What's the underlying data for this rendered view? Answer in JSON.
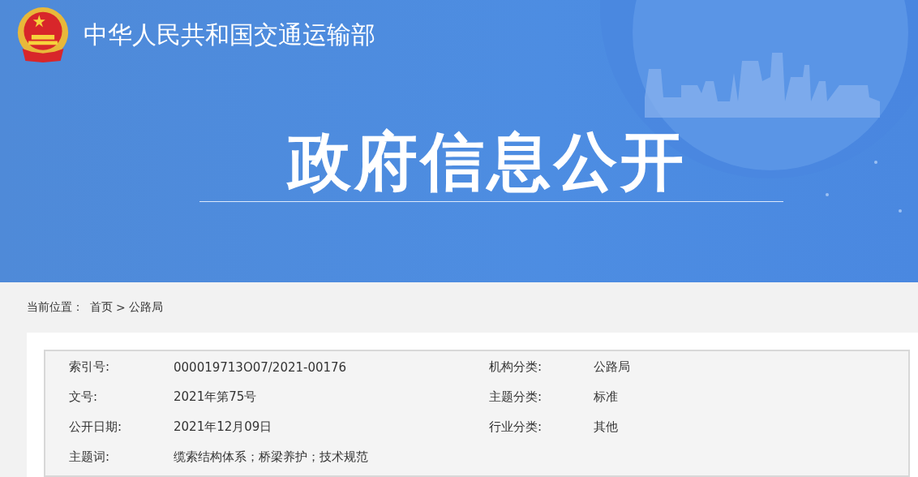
{
  "header": {
    "site_title": "中华人民共和国交通运输部",
    "banner_title": "政府信息公开"
  },
  "breadcrumb": {
    "label": "当前位置：",
    "separator": ">",
    "items": [
      "首页",
      "公路局"
    ]
  },
  "info_table": {
    "fields": [
      {
        "label": "索引号:",
        "value": "000019713O07/2021-00176"
      },
      {
        "label": "机构分类:",
        "value": "公路局"
      },
      {
        "label": "文号:",
        "value": "2021年第75号"
      },
      {
        "label": "主题分类:",
        "value": "标准"
      },
      {
        "label": "公开日期:",
        "value": "2021年12月09日"
      },
      {
        "label": "行业分类:",
        "value": "其他"
      },
      {
        "label": "主题词:",
        "value": "缆索结构体系；桥梁养护；技术规范"
      }
    ]
  }
}
